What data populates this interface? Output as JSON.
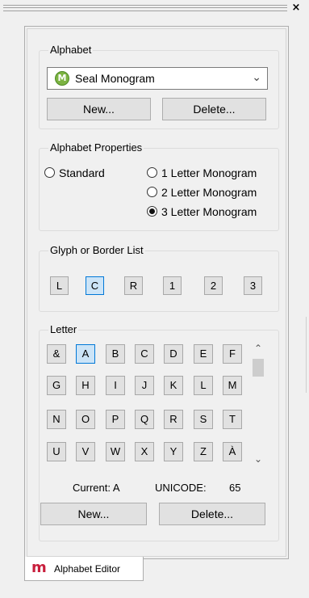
{
  "window": {
    "close_glyph": "×"
  },
  "alphabet": {
    "legend": "Alphabet",
    "selected": "Seal Monogram",
    "selected_icon": "monogram-logo-icon",
    "new_label": "New...",
    "delete_label": "Delete..."
  },
  "properties": {
    "legend": "Alphabet Properties",
    "options": [
      {
        "label": "Standard",
        "checked": false
      },
      {
        "label": "1 Letter Monogram",
        "checked": false
      },
      {
        "label": "2 Letter Monogram",
        "checked": false
      },
      {
        "label": "3 Letter Monogram",
        "checked": true
      }
    ]
  },
  "glyphs": {
    "legend": "Glyph or Border List",
    "buttons": [
      {
        "label": "L",
        "selected": false
      },
      {
        "label": "C",
        "selected": true
      },
      {
        "label": "R",
        "selected": false
      },
      {
        "label": "1",
        "selected": false
      },
      {
        "label": "2",
        "selected": false
      },
      {
        "label": "3",
        "selected": false
      }
    ]
  },
  "letter": {
    "legend": "Letter",
    "rows": [
      [
        "&",
        "A",
        "B",
        "C",
        "D",
        "E",
        "F"
      ],
      [
        "G",
        "H",
        "I",
        "J",
        "K",
        "L",
        "M"
      ],
      [
        "N",
        "O",
        "P",
        "Q",
        "R",
        "S",
        "T"
      ],
      [
        "U",
        "V",
        "W",
        "X",
        "Y",
        "Z",
        "À"
      ]
    ],
    "selected": "A",
    "current_label": "Current: A",
    "unicode_label": "UNICODE:",
    "unicode_value": "65",
    "new_label": "New...",
    "delete_label": "Delete..."
  },
  "tab": {
    "label": "Alphabet Editor",
    "icon": "m-logo-icon",
    "icon_glyph": "m"
  },
  "colors": {
    "selection_border": "#0078d7",
    "selection_fill": "#cce4f7",
    "tab_logo": "#c81e3c",
    "alphabet_logo": "#7cb342"
  }
}
